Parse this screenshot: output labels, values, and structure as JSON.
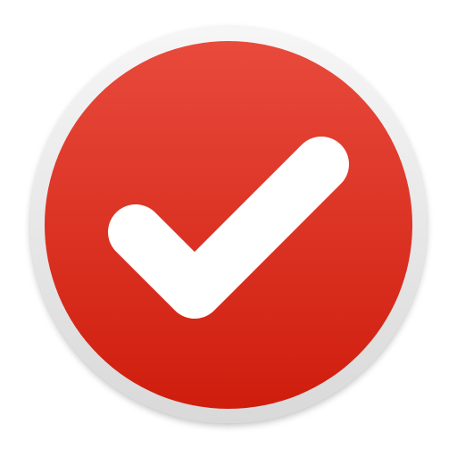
{
  "icon": {
    "name": "checkmark-app-icon",
    "colors": {
      "background": "#ffffff",
      "ring_light": "#f6f6f6",
      "ring_dark": "#d9d9d9",
      "disc_top": "#e84a3c",
      "disc_bottom": "#cf1d0d",
      "check": "#ffffff"
    }
  }
}
